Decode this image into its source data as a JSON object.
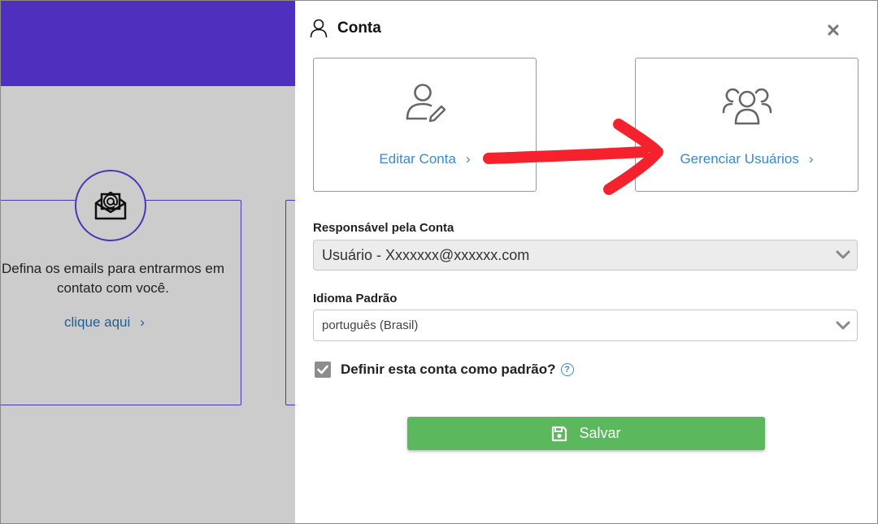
{
  "background": {
    "card_text": "Defina os emails para entrarmos em contato com você.",
    "card_link": "clique aqui"
  },
  "modal": {
    "title": "Conta",
    "cards": [
      {
        "label": "Editar Conta",
        "icon": "user-edit-icon"
      },
      {
        "label": "Gerenciar Usuários",
        "icon": "users-group-icon"
      }
    ],
    "owner_label": "Responsável pela Conta",
    "owner_value": "Usuário - Xxxxxxx@xxxxxx.com",
    "language_label": "Idioma Padrão",
    "language_value": "português (Brasil)",
    "default_label": "Definir esta conta como padrão?",
    "default_checked": true,
    "save_label": "Salvar"
  },
  "colors": {
    "header_purple": "#4f2fbd",
    "link_blue": "#3a88d0",
    "save_green": "#5cb85c",
    "annotation_red": "#f5222d"
  }
}
